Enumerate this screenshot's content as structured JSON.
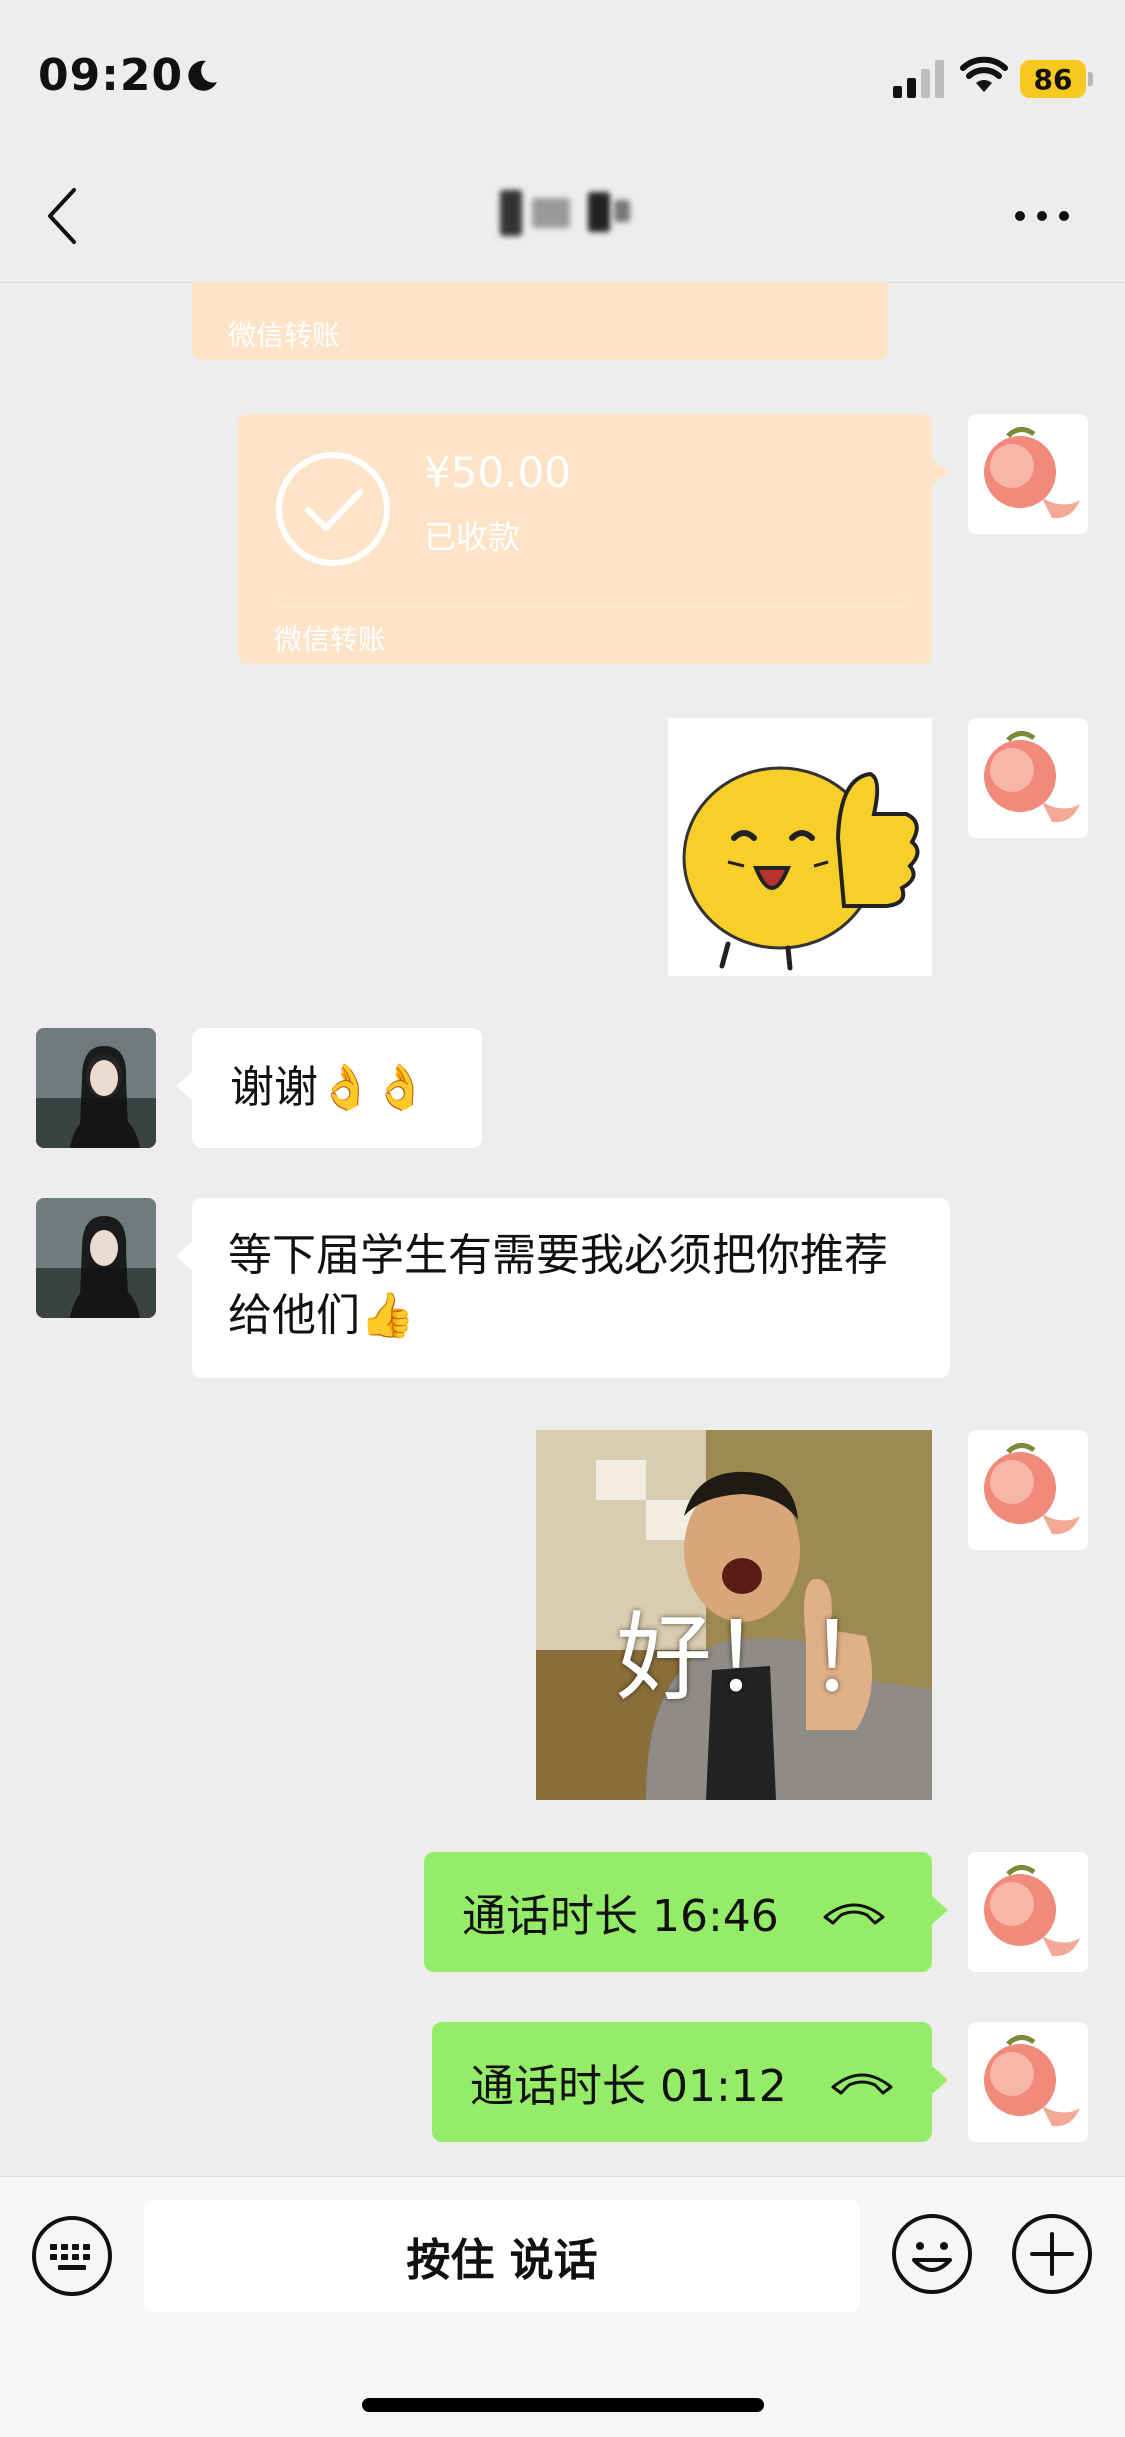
{
  "status_bar": {
    "time": "09:20",
    "battery": "86"
  },
  "nav": {
    "title": ""
  },
  "messages": {
    "transfer_partial_footer": "微信转账",
    "transfer": {
      "amount": "¥50.00",
      "status": "已收款",
      "footer": "微信转账"
    },
    "sticker_thumbs_up": "thumbs-up yellow blob sticker",
    "peer_text_1": "谢谢👌👌",
    "peer_text_2": "等下届学生有需要我必须把你推荐给他们👍",
    "meme_caption": "好！！",
    "call_1": "通话时长 16:46",
    "call_2": "通话时长 01:12"
  },
  "input_bar": {
    "hold_to_talk": "按住 说话"
  },
  "colors": {
    "background": "#ededed",
    "green_bubble": "#95ec69",
    "transfer_bg": "#fde3c7",
    "battery": "#f7c81d"
  },
  "icons": [
    "moon-icon",
    "signal-icon",
    "wifi-icon",
    "back-icon",
    "more-icon",
    "check-circle-icon",
    "hangup-phone-icon",
    "keyboard-icon",
    "emoji-icon",
    "plus-icon"
  ]
}
